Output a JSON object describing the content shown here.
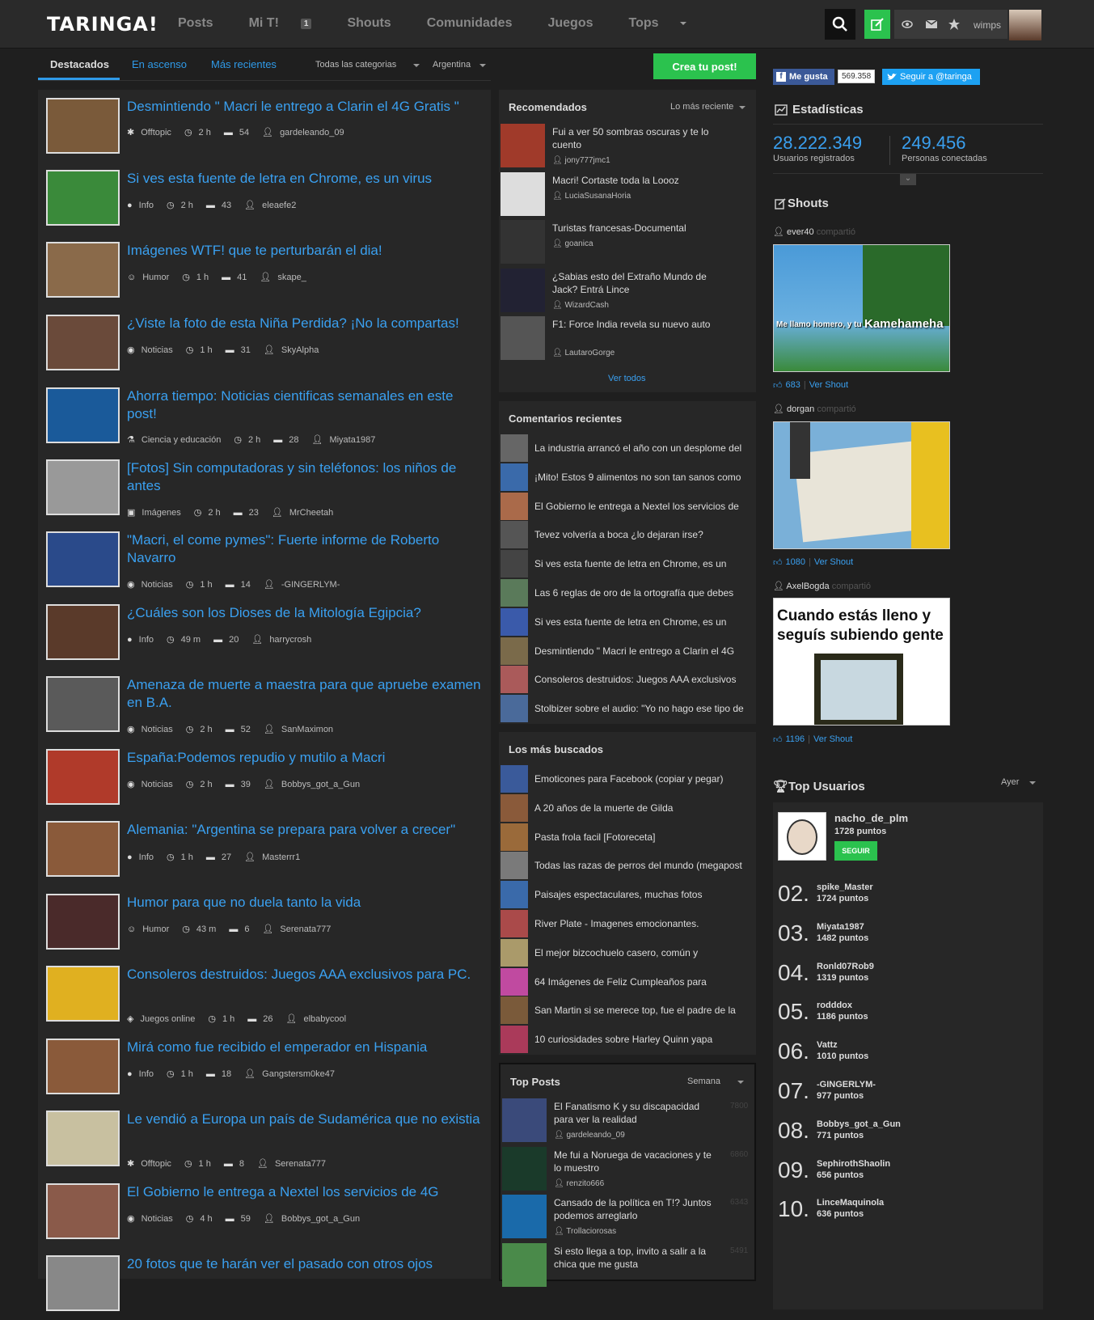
{
  "header": {
    "logo": "TARINGA!",
    "nav": [
      {
        "label": "Posts"
      },
      {
        "label": "Mi T!",
        "count": "1"
      },
      {
        "label": "Shouts"
      },
      {
        "label": "Comunidades"
      },
      {
        "label": "Juegos"
      },
      {
        "label": "Tops"
      }
    ],
    "username": "wimps"
  },
  "subnav": {
    "tabs": [
      "Destacados",
      "En ascenso",
      "Más recientes"
    ],
    "category": "Todas las categorias",
    "country": "Argentina",
    "create": "Crea tu post!"
  },
  "posts": [
    {
      "title": "Desmintiendo \" Macri le entrego a Clarin el 4G Gratis \"",
      "cat": "Offtopic",
      "time": "2 h",
      "comments": "54",
      "user": "gardeleando_09",
      "c": "#7a5a3a"
    },
    {
      "title": "Si ves esta fuente de letra en Chrome, es un virus",
      "cat": "Info",
      "time": "2 h",
      "comments": "43",
      "user": "eleaefe2",
      "c": "#3a8a3a"
    },
    {
      "title": "Imágenes WTF! que te perturbarán el dia!",
      "cat": "Humor",
      "time": "1 h",
      "comments": "41",
      "user": "skape_",
      "c": "#8a6a4a"
    },
    {
      "title": "¿Viste la foto de esta Niña Perdida? ¡No la compartas!",
      "cat": "Noticias",
      "time": "1 h",
      "comments": "31",
      "user": "SkyAlpha",
      "c": "#6a4a3a"
    },
    {
      "title": "Ahorra tiempo: Noticias cientificas semanales en este post!",
      "cat": "Ciencia y educación",
      "time": "2 h",
      "comments": "28",
      "user": "Miyata1987",
      "c": "#1a5a9a"
    },
    {
      "title": "[Fotos] Sin computadoras y sin teléfonos: los niños de antes",
      "cat": "Imágenes",
      "time": "2 h",
      "comments": "23",
      "user": "MrCheetah",
      "c": "#999"
    },
    {
      "title": "\"Macri, el come pymes\": Fuerte informe de Roberto Navarro",
      "cat": "Noticias",
      "time": "1 h",
      "comments": "14",
      "user": "-GINGERLYM-",
      "c": "#2a4a8a"
    },
    {
      "title": "¿Cuáles son los Dioses de la Mitología Egipcia?",
      "cat": "Info",
      "time": "49 m",
      "comments": "20",
      "user": "harrycrosh",
      "c": "#5a3a2a"
    },
    {
      "title": "Amenaza de muerte a maestra para que apruebe examen en B.A.",
      "cat": "Noticias",
      "time": "2 h",
      "comments": "52",
      "user": "SanMaximon",
      "c": "#5a5a5a"
    },
    {
      "title": "España:Podemos repudio y mutilo a Macri",
      "cat": "Noticias",
      "time": "2 h",
      "comments": "39",
      "user": "Bobbys_got_a_Gun",
      "c": "#b03a2a"
    },
    {
      "title": "Alemania: \"Argentina se prepara para volver a crecer\"",
      "cat": "Info",
      "time": "1 h",
      "comments": "27",
      "user": "Masterrr1",
      "c": "#8a5a3a"
    },
    {
      "title": "Humor para que no duela tanto la vida",
      "cat": "Humor",
      "time": "43 m",
      "comments": "6",
      "user": "Serenata777",
      "c": "#4a2a2a"
    },
    {
      "title": "Consoleros destruidos: Juegos AAA exclusivos para PC.",
      "cat": "Juegos online",
      "time": "1 h",
      "comments": "26",
      "user": "elbabycool",
      "c": "#e0b020"
    },
    {
      "title": "Mirá como fue recibido el emperador en Hispania",
      "cat": "Info",
      "time": "1 h",
      "comments": "18",
      "user": "Gangstersm0ke47",
      "c": "#8a5a3a"
    },
    {
      "title": "Le vendió a Europa un país de Sudamérica que no existia",
      "cat": "Offtopic",
      "time": "1 h",
      "comments": "8",
      "user": "Serenata777",
      "c": "#c8c0a0"
    },
    {
      "title": "El Gobierno le entrega a Nextel los servicios de 4G",
      "cat": "Noticias",
      "time": "4 h",
      "comments": "59",
      "user": "Bobbys_got_a_Gun",
      "c": "#8a5a4a"
    },
    {
      "title": "20 fotos que te harán ver el pasado con otros ojos",
      "cat": "",
      "time": "",
      "comments": "",
      "user": "",
      "c": "#888"
    }
  ],
  "recomendados": {
    "title": "Recomendados",
    "sort": "Lo más reciente",
    "more": "Ver todos",
    "items": [
      {
        "title": "Fui a ver 50 sombras oscuras y te lo cuento",
        "user": "jony777jmc1",
        "c": "#a03a2a"
      },
      {
        "title": "Macri! Cortaste toda la Loooz",
        "user": "LuciaSusanaHoria",
        "c": "#ddd"
      },
      {
        "title": "Turistas francesas-Documental",
        "user": "goanica",
        "c": "#333"
      },
      {
        "title": "¿Sabias esto del Extraño Mundo de Jack? Entrá Lince",
        "user": "WizardCash",
        "c": "#223"
      },
      {
        "title": "F1: Force India revela su nuevo auto",
        "user": "LautaroGorge",
        "c": "#555"
      }
    ]
  },
  "comentarios": {
    "title": "Comentarios recientes",
    "items": [
      {
        "text": "La industria arrancó el año con un desplome del",
        "c": "#666"
      },
      {
        "text": "¡Mito! Estos 9 alimentos no son tan sanos como",
        "c": "#3a6aaa"
      },
      {
        "text": "El Gobierno le entrega a Nextel los servicios de",
        "c": "#aa6a4a"
      },
      {
        "text": "Tevez volvería a boca ¿lo dejaran irse?",
        "c": "#555"
      },
      {
        "text": "Si ves esta fuente de letra en Chrome, es un",
        "c": "#444"
      },
      {
        "text": "Las 6 reglas de oro de la ortografía que debes",
        "c": "#5a7a5a"
      },
      {
        "text": "Si ves esta fuente de letra en Chrome, es un",
        "c": "#3a5aaa"
      },
      {
        "text": "Desmintiendo \" Macri le entrego a Clarin el 4G",
        "c": "#7a6a4a"
      },
      {
        "text": "Consoleros destruidos: Juegos AAA exclusivos",
        "c": "#aa5a5a"
      },
      {
        "text": "Stolbizer sobre el audio: \"Yo no hago ese tipo de",
        "c": "#4a6a9a"
      }
    ]
  },
  "buscados": {
    "title": "Los más buscados",
    "items": [
      {
        "text": "Emoticones para Facebook (copiar y pegar)",
        "c": "#3a5a9a"
      },
      {
        "text": "A 20 años de la muerte de Gilda",
        "c": "#8a5a3a"
      },
      {
        "text": "Pasta frola facil [Fotoreceta]",
        "c": "#9a6a3a"
      },
      {
        "text": "Todas las razas de perros del mundo (megapost",
        "c": "#7a7a7a"
      },
      {
        "text": "Paisajes espectaculares, muchas fotos",
        "c": "#3a6aaa"
      },
      {
        "text": "River Plate - Imagenes emocionantes.",
        "c": "#aa4a4a"
      },
      {
        "text": "El mejor bizcochuelo casero, común y",
        "c": "#aa9a6a"
      },
      {
        "text": "64 Imágenes de Feliz Cumpleaños para",
        "c": "#c04aa0"
      },
      {
        "text": "San Martin si se merece top, fue el padre de la",
        "c": "#7a5a3a"
      },
      {
        "text": "10 curiosidades sobre Harley Quinn yapa",
        "c": "#aa3a5a"
      }
    ]
  },
  "topposts": {
    "title": "Top Posts",
    "period": "Semana",
    "items": [
      {
        "title": "El Fanatismo K y su discapacidad para ver la realidad",
        "user": "gardeleando_09",
        "score": "7800",
        "c": "#3a4a7a"
      },
      {
        "title": "Me fui a Noruega de vacaciones y te lo muestro",
        "user": "renzito666",
        "score": "6860",
        "c": "#1a3a2a"
      },
      {
        "title": "Cansado de la política en T!? Juntos podemos arreglarlo",
        "user": "Trollaciorosas",
        "score": "6343",
        "c": "#1a6aaa"
      },
      {
        "title": "Si esto llega a top, invito a salir a la chica que me gusta",
        "user": "",
        "score": "5491",
        "c": "#4a8a4a"
      }
    ]
  },
  "social": {
    "like": "Me gusta",
    "like_count": "569.358",
    "follow": "Seguir a @taringa"
  },
  "stats": {
    "title": "Estadísticas",
    "users": "28.222.349",
    "users_label": "Usuarios registrados",
    "online": "249.456",
    "online_label": "Personas conectadas"
  },
  "shouts": {
    "title": "Shouts",
    "shared": "compartió",
    "see": "Ver Shout",
    "items": [
      {
        "user": "ever40",
        "likes": "683",
        "caption1": "Me llamo homero, y tu",
        "caption2": "Kamehameha"
      },
      {
        "user": "dorgan",
        "likes": "1080"
      },
      {
        "user": "AxelBogda",
        "likes": "1196",
        "caption": "Cuando estás lleno y seguís subiendo gente"
      }
    ]
  },
  "topusers": {
    "title": "Top Usuarios",
    "period": "Ayer",
    "first": {
      "user": "nacho_de_plm",
      "points": "1728 puntos",
      "follow": "SEGUIR"
    },
    "rest": [
      {
        "n": "02.",
        "user": "spike_Master",
        "points": "1724 puntos"
      },
      {
        "n": "03.",
        "user": "Miyata1987",
        "points": "1482 puntos"
      },
      {
        "n": "04.",
        "user": "Ronld07Rob9",
        "points": "1319 puntos"
      },
      {
        "n": "05.",
        "user": "rodddox",
        "points": "1186 puntos"
      },
      {
        "n": "06.",
        "user": "Vattz",
        "points": "1010 puntos"
      },
      {
        "n": "07.",
        "user": "-GINGERLYM-",
        "points": "977 puntos"
      },
      {
        "n": "08.",
        "user": "Bobbys_got_a_Gun",
        "points": "771 puntos"
      },
      {
        "n": "09.",
        "user": "SephirothShaolin",
        "points": "656 puntos"
      },
      {
        "n": "10.",
        "user": "LinceMaquinola",
        "points": "636 puntos"
      }
    ]
  }
}
